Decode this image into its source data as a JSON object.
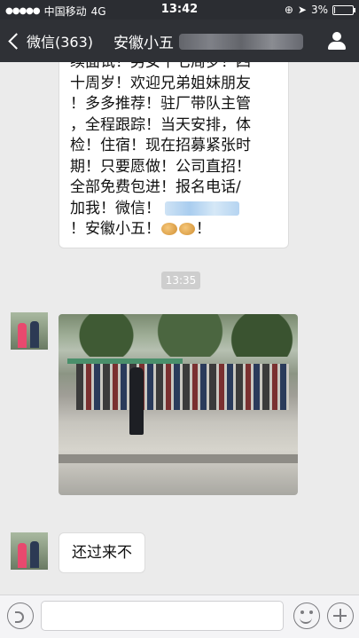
{
  "status_bar": {
    "carrier": "中国移动",
    "network": "4G",
    "time": "13:42",
    "battery_percent": "3%",
    "battery_level": 0.03
  },
  "nav": {
    "back_label": "微信(363)",
    "title": "安徽小五"
  },
  "messages": {
    "first_lines": [
      "续面试！男女十七周岁！四",
      "十周岁！欢迎兄弟姐妹朋友",
      "！多多推荐！驻厂带队主管",
      "，全程跟踪！当天安排，体",
      "检！住宿！现在招募紧张时",
      "期！只要愿做！公司直招！",
      "全部免费包进！报名电话/",
      "加我！微信！",
      "！安徽小五！",
      "！"
    ],
    "timestamp": "13:35",
    "last_text": "还过来不"
  },
  "colors": {
    "status_bg": "#2b2d32",
    "nav_bg": "#2f3136",
    "chat_bg": "#ebebeb"
  }
}
